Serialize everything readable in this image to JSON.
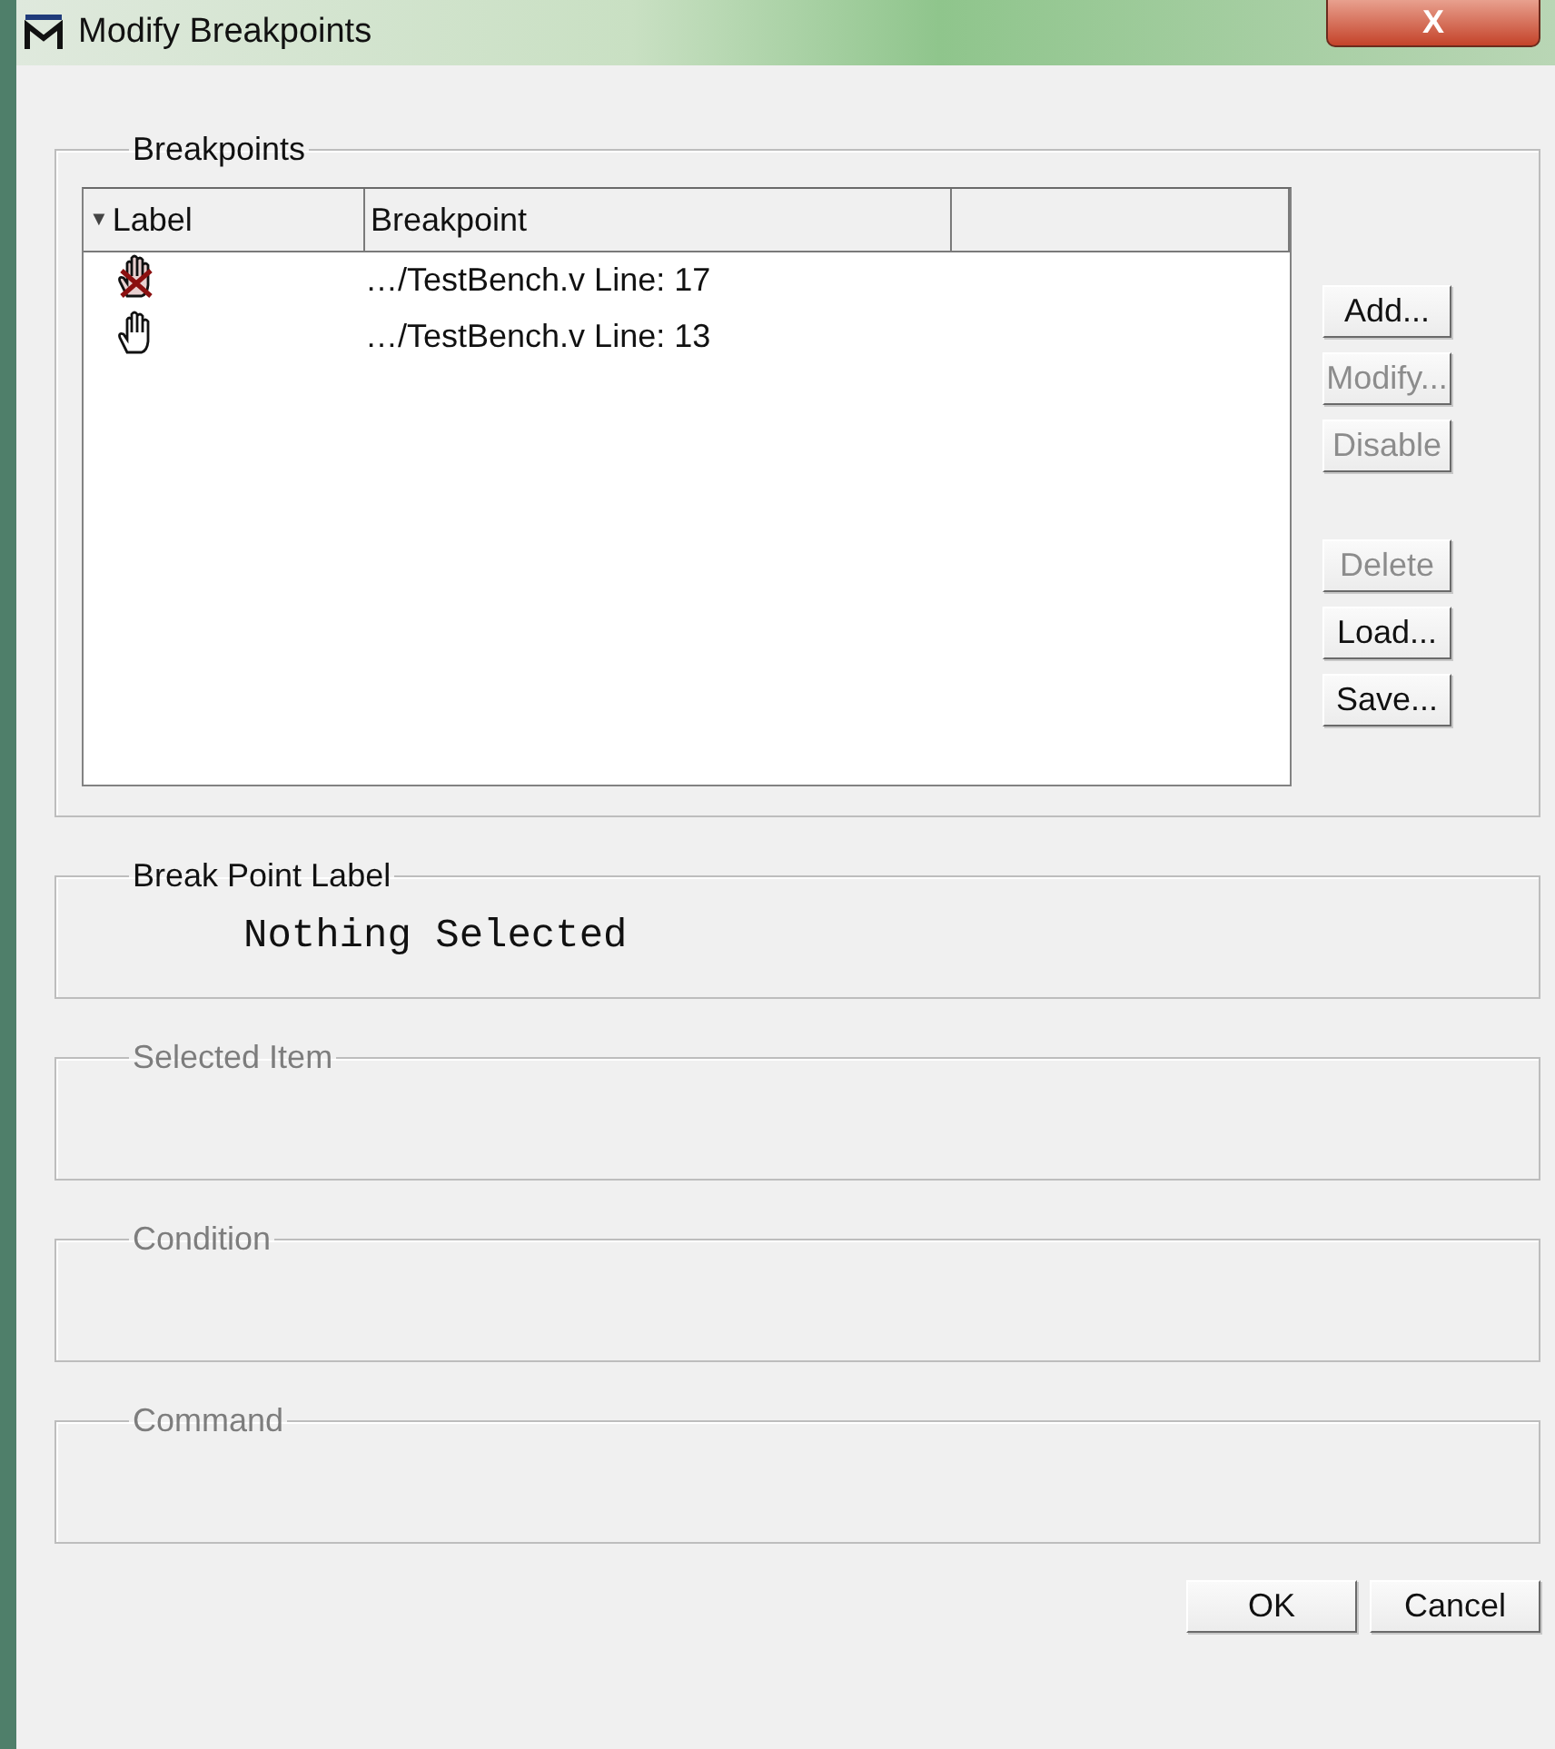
{
  "window": {
    "title": "Modify Breakpoints",
    "close": "X"
  },
  "breakpoints": {
    "title": "Breakpoints",
    "columns": [
      {
        "label": "Label",
        "sort": "▼"
      },
      {
        "label": "Breakpoint"
      },
      {}
    ],
    "rows": [
      {
        "enabled": false,
        "breakpoint": "…/TestBench.v Line: 17"
      },
      {
        "enabled": true,
        "breakpoint": "…/TestBench.v Line: 13"
      }
    ],
    "button_groups": [
      [
        {
          "label": "Add...",
          "disabled": false
        },
        {
          "label": "Modify...",
          "disabled": true
        },
        {
          "label": "Disable",
          "disabled": true
        }
      ],
      [
        {
          "label": "Delete",
          "disabled": true
        },
        {
          "label": "Load...",
          "disabled": false
        },
        {
          "label": "Save...",
          "disabled": false
        }
      ]
    ]
  },
  "groups": [
    {
      "title": "Break Point Label",
      "disabled": false,
      "value": "Nothing Selected"
    },
    {
      "title": "Selected Item",
      "disabled": true
    },
    {
      "title": "Condition",
      "disabled": true
    },
    {
      "title": "Command",
      "disabled": true
    }
  ],
  "buttons": [
    {
      "label": "OK"
    },
    {
      "label": "Cancel"
    }
  ]
}
